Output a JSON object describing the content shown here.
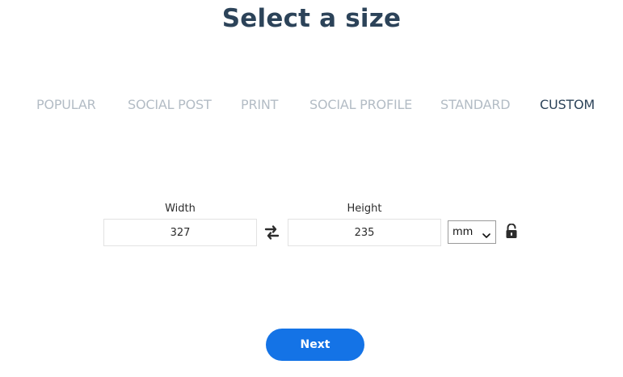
{
  "header": {
    "title": "Select a size"
  },
  "tabs": [
    {
      "label": "POPULAR",
      "active": false
    },
    {
      "label": "SOCIAL POST",
      "active": false
    },
    {
      "label": "PRINT",
      "active": false
    },
    {
      "label": "SOCIAL PROFILE",
      "active": false
    },
    {
      "label": "STANDARD",
      "active": false
    },
    {
      "label": "CUSTOM",
      "active": true
    }
  ],
  "dimensions": {
    "width_label": "Width",
    "width_value": "327",
    "height_label": "Height",
    "height_value": "235",
    "unit": "mm",
    "swap_icon": "swap-arrows-icon",
    "lock_icon": "unlocked-padlock-icon"
  },
  "actions": {
    "next_label": "Next"
  },
  "colors": {
    "title": "#2c4359",
    "tab_active": "#2c4359",
    "tab_inactive": "#b3bcc5",
    "button": "#1473e6",
    "button_text": "#ffffff"
  }
}
